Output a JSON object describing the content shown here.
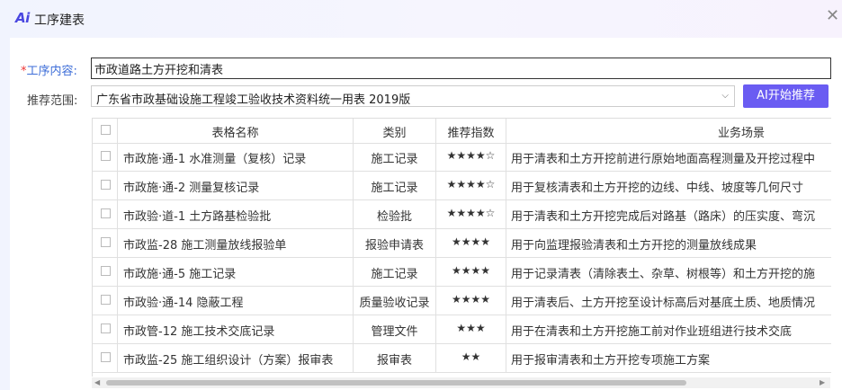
{
  "window": {
    "logo": "Ai",
    "title": "工序建表",
    "close": "✕"
  },
  "form": {
    "content_required": "*",
    "content_label": "工序内容:",
    "content_value": "市政道路土方开挖和清表",
    "range_label": "推荐范围:",
    "range_value": "广东省市政基础设施工程竣工验收技术资料统一用表 2019版",
    "ai_button": "AI开始推荐"
  },
  "table": {
    "headers": {
      "name": "表格名称",
      "category": "类别",
      "score": "推荐指数",
      "scenario": "业务场景"
    },
    "rows": [
      {
        "name": "市政施·通-1 水准测量（复核）记录",
        "category": "施工记录",
        "score": "★★★★☆",
        "scenario": "用于清表和土方开挖前进行原始地面高程测量及开挖过程中"
      },
      {
        "name": "市政施·通-2 测量复核记录",
        "category": "施工记录",
        "score": "★★★★☆",
        "scenario": "用于复核清表和土方开挖的边线、中线、坡度等几何尺寸"
      },
      {
        "name": "市政验·道-1 土方路基检验批",
        "category": "检验批",
        "score": "★★★★☆",
        "scenario": "用于清表和土方开挖完成后对路基（路床）的压实度、弯沉"
      },
      {
        "name": "市政监-28 施工测量放线报验单",
        "category": "报验申请表",
        "score": "★★★★",
        "scenario": "用于向监理报验清表和土方开挖的测量放线成果"
      },
      {
        "name": "市政施·通-5 施工记录",
        "category": "施工记录",
        "score": "★★★★",
        "scenario": "用于记录清表（清除表土、杂草、树根等）和土方开挖的施"
      },
      {
        "name": "市政验·通-14 隐蔽工程",
        "category": "质量验收记录",
        "score": "★★★★",
        "scenario": "用于清表后、土方开挖至设计标高后对基底土质、地质情况"
      },
      {
        "name": "市政管-12 施工技术交底记录",
        "category": "管理文件",
        "score": "★★★",
        "scenario": "用于在清表和土方开挖施工前对作业班组进行技术交底"
      },
      {
        "name": "市政监-25 施工组织设计（方案）报审表",
        "category": "报审表",
        "score": "★★",
        "scenario": "用于报审清表和土方开挖专项施工方案"
      }
    ]
  },
  "scrollbar": {
    "left_arrow": "◀",
    "right_arrow": "▶"
  },
  "colors": {
    "accent": "#6a5cf2",
    "label_blue": "#3e6ed8",
    "required_red": "#e33333"
  },
  "icons": {
    "logo": "ai-logo-icon",
    "close": "close-icon",
    "dropdown": "chevron-down-icon"
  }
}
